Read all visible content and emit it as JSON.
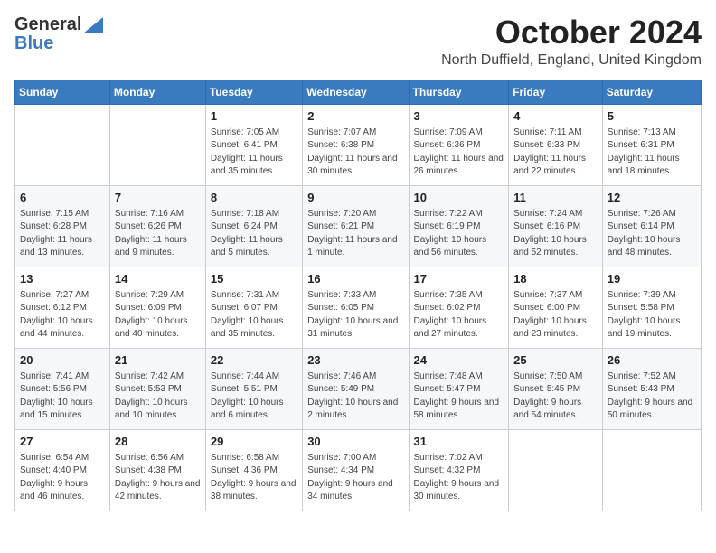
{
  "logo": {
    "line1": "General",
    "line2": "Blue"
  },
  "title": "October 2024",
  "location": "North Duffield, England, United Kingdom",
  "days_of_week": [
    "Sunday",
    "Monday",
    "Tuesday",
    "Wednesday",
    "Thursday",
    "Friday",
    "Saturday"
  ],
  "weeks": [
    [
      {
        "day": null
      },
      {
        "day": null
      },
      {
        "day": 1,
        "sunrise": "7:05 AM",
        "sunset": "6:41 PM",
        "daylight": "11 hours and 35 minutes."
      },
      {
        "day": 2,
        "sunrise": "7:07 AM",
        "sunset": "6:38 PM",
        "daylight": "11 hours and 30 minutes."
      },
      {
        "day": 3,
        "sunrise": "7:09 AM",
        "sunset": "6:36 PM",
        "daylight": "11 hours and 26 minutes."
      },
      {
        "day": 4,
        "sunrise": "7:11 AM",
        "sunset": "6:33 PM",
        "daylight": "11 hours and 22 minutes."
      },
      {
        "day": 5,
        "sunrise": "7:13 AM",
        "sunset": "6:31 PM",
        "daylight": "11 hours and 18 minutes."
      }
    ],
    [
      {
        "day": 6,
        "sunrise": "7:15 AM",
        "sunset": "6:28 PM",
        "daylight": "11 hours and 13 minutes."
      },
      {
        "day": 7,
        "sunrise": "7:16 AM",
        "sunset": "6:26 PM",
        "daylight": "11 hours and 9 minutes."
      },
      {
        "day": 8,
        "sunrise": "7:18 AM",
        "sunset": "6:24 PM",
        "daylight": "11 hours and 5 minutes."
      },
      {
        "day": 9,
        "sunrise": "7:20 AM",
        "sunset": "6:21 PM",
        "daylight": "11 hours and 1 minute."
      },
      {
        "day": 10,
        "sunrise": "7:22 AM",
        "sunset": "6:19 PM",
        "daylight": "10 hours and 56 minutes."
      },
      {
        "day": 11,
        "sunrise": "7:24 AM",
        "sunset": "6:16 PM",
        "daylight": "10 hours and 52 minutes."
      },
      {
        "day": 12,
        "sunrise": "7:26 AM",
        "sunset": "6:14 PM",
        "daylight": "10 hours and 48 minutes."
      }
    ],
    [
      {
        "day": 13,
        "sunrise": "7:27 AM",
        "sunset": "6:12 PM",
        "daylight": "10 hours and 44 minutes."
      },
      {
        "day": 14,
        "sunrise": "7:29 AM",
        "sunset": "6:09 PM",
        "daylight": "10 hours and 40 minutes."
      },
      {
        "day": 15,
        "sunrise": "7:31 AM",
        "sunset": "6:07 PM",
        "daylight": "10 hours and 35 minutes."
      },
      {
        "day": 16,
        "sunrise": "7:33 AM",
        "sunset": "6:05 PM",
        "daylight": "10 hours and 31 minutes."
      },
      {
        "day": 17,
        "sunrise": "7:35 AM",
        "sunset": "6:02 PM",
        "daylight": "10 hours and 27 minutes."
      },
      {
        "day": 18,
        "sunrise": "7:37 AM",
        "sunset": "6:00 PM",
        "daylight": "10 hours and 23 minutes."
      },
      {
        "day": 19,
        "sunrise": "7:39 AM",
        "sunset": "5:58 PM",
        "daylight": "10 hours and 19 minutes."
      }
    ],
    [
      {
        "day": 20,
        "sunrise": "7:41 AM",
        "sunset": "5:56 PM",
        "daylight": "10 hours and 15 minutes."
      },
      {
        "day": 21,
        "sunrise": "7:42 AM",
        "sunset": "5:53 PM",
        "daylight": "10 hours and 10 minutes."
      },
      {
        "day": 22,
        "sunrise": "7:44 AM",
        "sunset": "5:51 PM",
        "daylight": "10 hours and 6 minutes."
      },
      {
        "day": 23,
        "sunrise": "7:46 AM",
        "sunset": "5:49 PM",
        "daylight": "10 hours and 2 minutes."
      },
      {
        "day": 24,
        "sunrise": "7:48 AM",
        "sunset": "5:47 PM",
        "daylight": "9 hours and 58 minutes."
      },
      {
        "day": 25,
        "sunrise": "7:50 AM",
        "sunset": "5:45 PM",
        "daylight": "9 hours and 54 minutes."
      },
      {
        "day": 26,
        "sunrise": "7:52 AM",
        "sunset": "5:43 PM",
        "daylight": "9 hours and 50 minutes."
      }
    ],
    [
      {
        "day": 27,
        "sunrise": "6:54 AM",
        "sunset": "4:40 PM",
        "daylight": "9 hours and 46 minutes."
      },
      {
        "day": 28,
        "sunrise": "6:56 AM",
        "sunset": "4:38 PM",
        "daylight": "9 hours and 42 minutes."
      },
      {
        "day": 29,
        "sunrise": "6:58 AM",
        "sunset": "4:36 PM",
        "daylight": "9 hours and 38 minutes."
      },
      {
        "day": 30,
        "sunrise": "7:00 AM",
        "sunset": "4:34 PM",
        "daylight": "9 hours and 34 minutes."
      },
      {
        "day": 31,
        "sunrise": "7:02 AM",
        "sunset": "4:32 PM",
        "daylight": "9 hours and 30 minutes."
      },
      {
        "day": null
      },
      {
        "day": null
      }
    ]
  ]
}
